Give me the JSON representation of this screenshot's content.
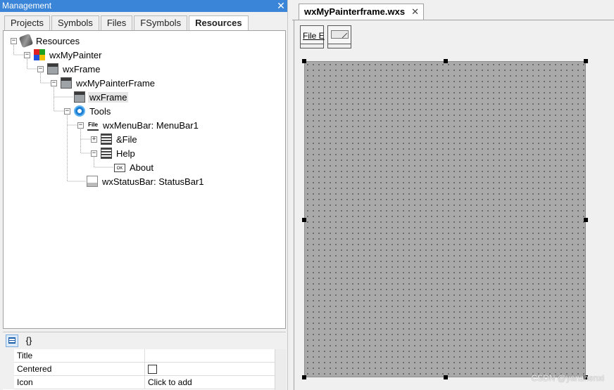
{
  "management": {
    "title": "Management",
    "close": "✕",
    "tabs": [
      {
        "label": "Projects"
      },
      {
        "label": "Symbols"
      },
      {
        "label": "Files"
      },
      {
        "label": "FSymbols"
      },
      {
        "label": "Resources"
      }
    ],
    "active_tab": "Resources",
    "tree": [
      {
        "label": "Resources",
        "icon": "resources-icon",
        "expander": "−"
      },
      {
        "label": "wxMyPainter",
        "icon": "wx-app-icon",
        "expander": "−"
      },
      {
        "label": "wxFrame",
        "icon": "frame-icon",
        "expander": "−"
      },
      {
        "label": "wxMyPainterFrame",
        "icon": "frame-icon",
        "expander": "−"
      },
      {
        "label": "wxFrame",
        "icon": "frame-icon",
        "expander": ""
      },
      {
        "label": "Tools",
        "icon": "tools-icon",
        "expander": "−"
      },
      {
        "label": "wxMenuBar: MenuBar1",
        "icon": "menubar-icon",
        "expander": "−"
      },
      {
        "label": "&File",
        "icon": "menu-icon",
        "expander": "+"
      },
      {
        "label": "Help",
        "icon": "menu-icon",
        "expander": "−"
      },
      {
        "label": "About",
        "icon": "menuitem-icon",
        "expander": ""
      },
      {
        "label": "wxStatusBar: StatusBar1",
        "icon": "statusbar-icon",
        "expander": ""
      }
    ],
    "menubar_icon_text": "File",
    "menuitem_icon_text": "OK",
    "property_toolbar": {
      "list_icon": "property-list-icon",
      "events_label": "{}"
    },
    "properties": [
      {
        "name": "Title",
        "value": ""
      },
      {
        "name": "Centered",
        "value": "",
        "checkbox": true
      },
      {
        "name": "Icon",
        "value": "Click to add"
      }
    ]
  },
  "editor": {
    "tab_label": "wxMyPainterframe.wxs",
    "tab_close": "✕",
    "tool_menubar_text": "File  E",
    "watermark": "CSDN @yanzhenxi"
  },
  "colors": {
    "title_bar": "#3a85d8",
    "canvas": "#a9a9a9",
    "selection": "#e6e6e6"
  }
}
